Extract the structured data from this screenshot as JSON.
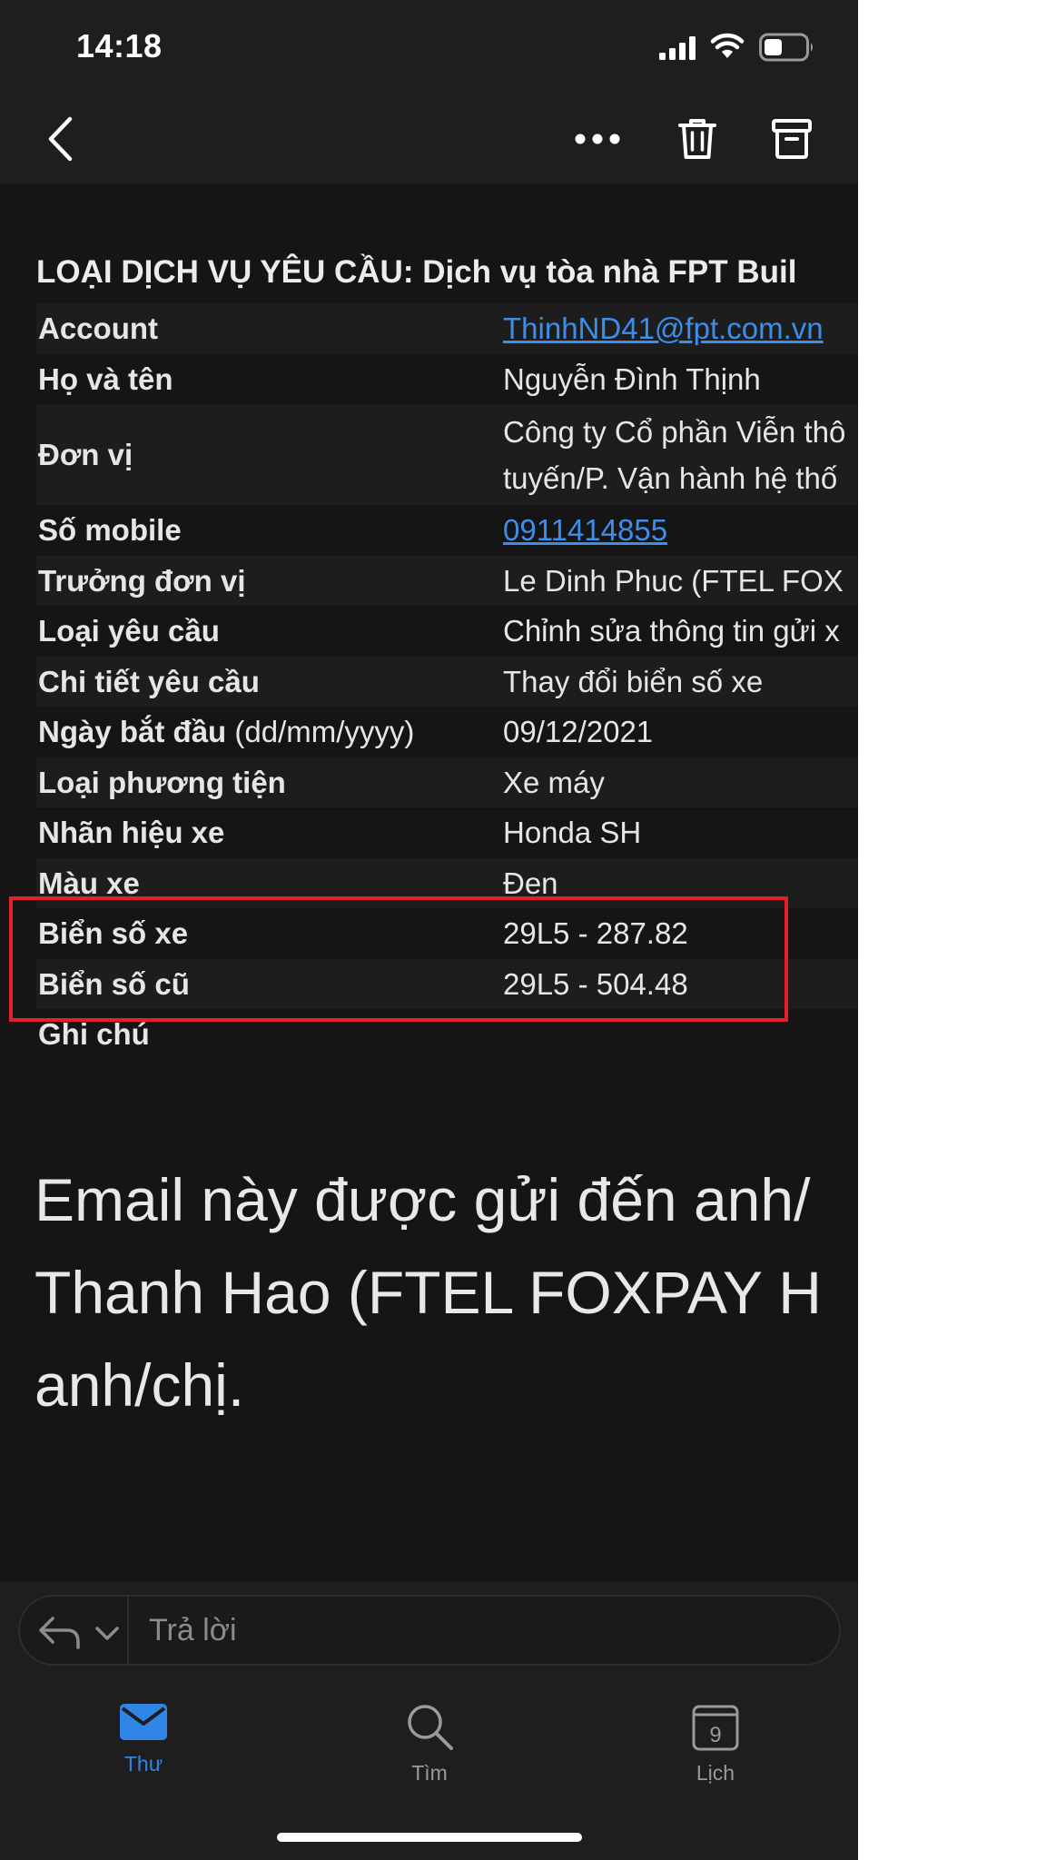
{
  "status_bar": {
    "time": "14:18"
  },
  "email": {
    "subject": "LOẠI DỊCH VỤ YÊU CẦU: Dịch vụ tòa nhà FPT Buil",
    "rows": [
      {
        "label": "Account",
        "value": "ThinhND41@fpt.com.vn",
        "link": true
      },
      {
        "label": "Họ và tên",
        "value": "Nguyễn Đình Thịnh"
      },
      {
        "label": "Đơn vị",
        "value": "Công ty Cổ phần Viễn thô",
        "value2": "tuyến/P. Vận hành hệ thố"
      },
      {
        "label": "Số mobile",
        "value": "0911414855",
        "link": true
      },
      {
        "label": "Trưởng đơn vị",
        "value": "Le Dinh Phuc (FTEL FOX"
      },
      {
        "label": "Loại yêu cầu",
        "value": "Chỉnh sửa thông tin gửi x"
      },
      {
        "label": "Chi tiết yêu cầu",
        "value": "Thay đổi biển số xe"
      },
      {
        "label": "Ngày bắt đầu",
        "label_note": "(dd/mm/yyyy)",
        "value": "09/12/2021"
      },
      {
        "label": "Loại phương tiện",
        "value": "Xe máy"
      },
      {
        "label": "Nhãn hiệu xe",
        "value": "Honda SH"
      },
      {
        "label": "Màu xe",
        "value": "Đen"
      },
      {
        "label": "Biển số xe",
        "value": "29L5 - 287.82"
      },
      {
        "label": "Biển số cũ",
        "value": "29L5 - 504.48"
      },
      {
        "label": "Ghi chú",
        "value": ""
      }
    ],
    "footer_lines": [
      "Email này được gửi đến anh/",
      "Thanh Hao (FTEL FOXPAY H",
      "anh/chị."
    ]
  },
  "reply": {
    "placeholder": "Trả lời"
  },
  "tabs": [
    {
      "label": "Thư",
      "icon": "mail-icon",
      "active": true
    },
    {
      "label": "Tìm",
      "icon": "search-icon",
      "active": false
    },
    {
      "label": "Lịch",
      "icon": "calendar-icon",
      "active": false,
      "calendar_day": "9"
    }
  ],
  "colors": {
    "accent": "#2f86e6",
    "highlight_box": "#e0202a",
    "background": "#151515"
  }
}
